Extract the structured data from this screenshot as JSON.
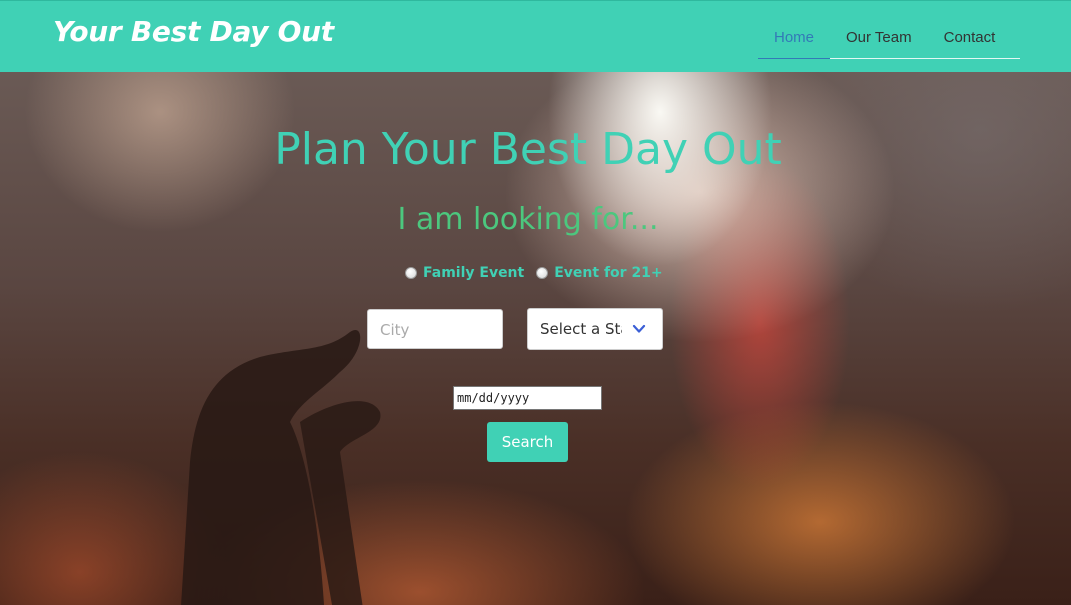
{
  "navbar": {
    "brand": "Your Best Day Out",
    "links": [
      {
        "label": "Home",
        "active": true
      },
      {
        "label": "Our Team",
        "active": false
      },
      {
        "label": "Contact",
        "active": false
      }
    ]
  },
  "hero": {
    "title": "Plan Your Best Day Out",
    "subtitle": "I am looking for...",
    "options": [
      {
        "label": "Family Event",
        "selected": false
      },
      {
        "label": "Event for 21+",
        "selected": false
      }
    ],
    "city": {
      "value": "",
      "placeholder": "City"
    },
    "state": {
      "value": "Select a State"
    },
    "date": {
      "value": "mm/dd/yyyy"
    },
    "search_label": "Search"
  },
  "colors": {
    "accent": "#40d1b5",
    "subtitle": "#4cc77e",
    "nav_active": "#337ab7"
  }
}
